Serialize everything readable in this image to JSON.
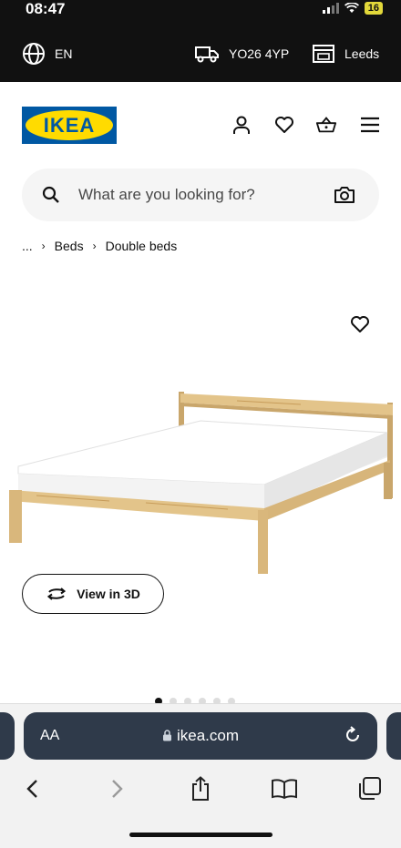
{
  "status": {
    "time": "08:47",
    "battery": "16"
  },
  "utility": {
    "language": "EN",
    "postcode": "YO26 4YP",
    "store": "Leeds"
  },
  "logo": {
    "text": "IKEA"
  },
  "search": {
    "placeholder": "What are you looking for?"
  },
  "breadcrumb": {
    "ellipsis": "...",
    "items": [
      "Beds",
      "Double beds"
    ]
  },
  "product": {
    "view3d_label": "View in 3D"
  },
  "carousel": {
    "count": 6,
    "active": 0
  },
  "browser": {
    "text_size": "AA",
    "url": "ikea.com"
  },
  "colors": {
    "ikea_blue": "#0058a3",
    "ikea_yellow": "#ffdb00",
    "topbar": "#111111",
    "urlbar": "#2f3a4a"
  }
}
